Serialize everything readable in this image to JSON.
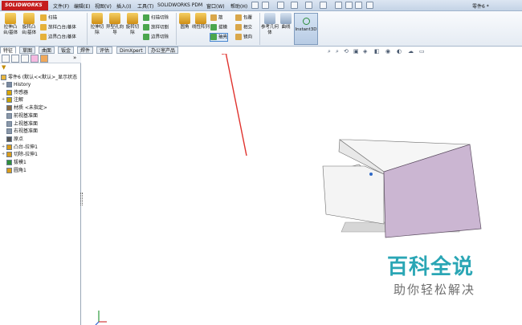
{
  "app": {
    "logo_text": "SOLIDWORKS",
    "brand_color": "#c51d1d",
    "document_title": "零件6 *"
  },
  "menu": [
    "文件(F)",
    "编辑(E)",
    "视图(V)",
    "插入(I)",
    "工具(T)",
    "SOLIDWORKS PDM",
    "窗口(W)",
    "帮助(H)"
  ],
  "commands": {
    "extrude_boss": "拉伸凸台/基体",
    "revolve_boss": "旋转凸台/基体",
    "sweep": "扫描",
    "loft_boss": "放样凸台/基体",
    "boundary_boss": "边界凸台/基体",
    "extrude_cut": "拉伸切除",
    "hole_wizard": "异型孔向导",
    "revolve_cut": "旋转切除",
    "swept_cut": "扫描切除",
    "lofted_cut": "放样切割",
    "boundary_cut": "边界切除",
    "fillet": "圆角",
    "linear_pattern": "线性阵列",
    "rib": "筋",
    "wrap": "包覆",
    "draft": "拔模",
    "intersect": "相交",
    "shell": "抽壳",
    "mirror": "镜向",
    "ref_geometry": "参考几何体",
    "curves": "曲线",
    "instant3d": "Instant3D"
  },
  "tabs": [
    "特征",
    "草图",
    "曲面",
    "钣金",
    "焊件",
    "评估",
    "DimXpert",
    "办公室产品"
  ],
  "active_tab": "特征",
  "feature_tree": {
    "root": "零件6 (默认<<默认>_显示状态",
    "items": [
      {
        "label": "History",
        "icon": "history-icon",
        "color": "#7b8aa0"
      },
      {
        "label": "传感器",
        "icon": "sensor-icon",
        "color": "#d9a400"
      },
      {
        "label": "注解",
        "icon": "annotation-icon",
        "color": "#c8a200"
      },
      {
        "label": "材质 <未指定>",
        "icon": "material-icon",
        "color": "#8a6a40"
      },
      {
        "label": "前视基准面",
        "icon": "plane-icon",
        "color": "#8a98aa"
      },
      {
        "label": "上视基准面",
        "icon": "plane-icon",
        "color": "#8a98aa"
      },
      {
        "label": "右视基准面",
        "icon": "plane-icon",
        "color": "#8a98aa"
      },
      {
        "label": "原点",
        "icon": "origin-icon",
        "color": "#555555"
      },
      {
        "label": "凸台-拉伸1",
        "icon": "extrude-icon",
        "color": "#d99b1a"
      },
      {
        "label": "切除-拉伸1",
        "icon": "cut-icon",
        "color": "#d99b1a"
      },
      {
        "label": "拔模1",
        "icon": "draft-icon",
        "color": "#2f8f3a"
      },
      {
        "label": "圆角1",
        "icon": "fillet-icon",
        "color": "#d99b1a"
      }
    ]
  },
  "watermark": {
    "title": "百科全说",
    "subtitle": "助你轻松解决",
    "color": "#2aa6b5"
  },
  "model": {
    "face_color": "#cbb6d2",
    "annotation_arrow_color": "#e0322d"
  }
}
